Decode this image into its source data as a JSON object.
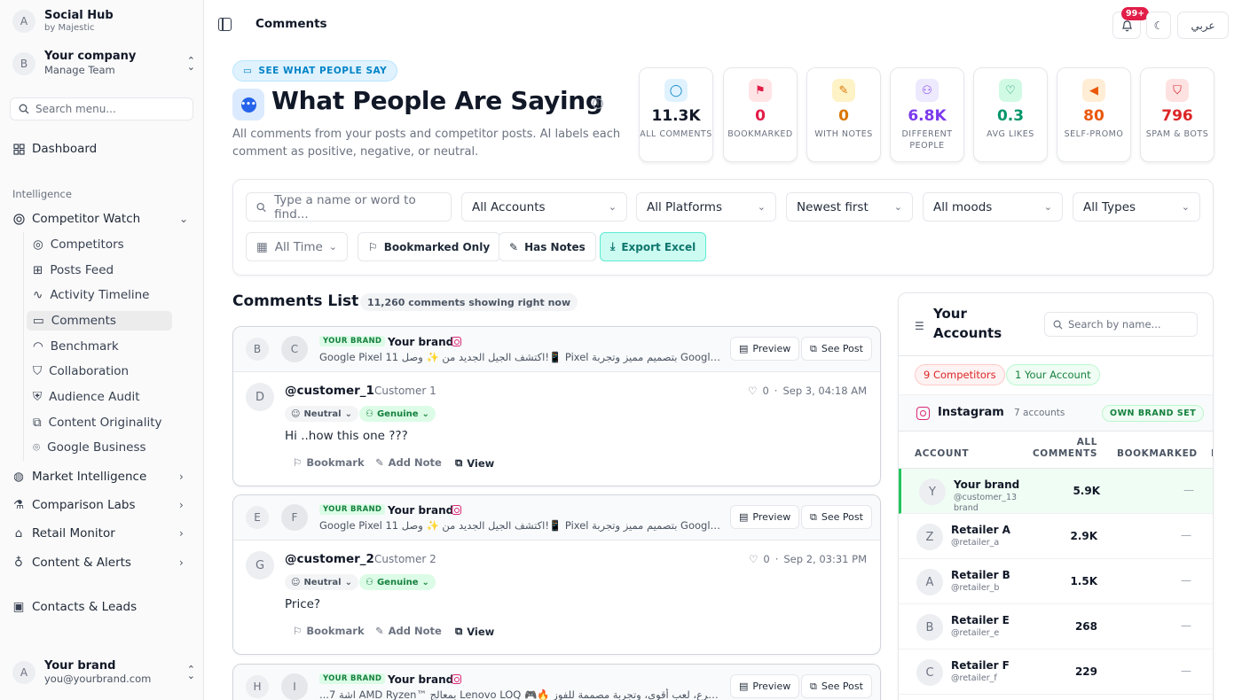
{
  "sidebar": {
    "brand_avatar": "A",
    "brand_title": "Social Hub",
    "brand_sub": "by Majestic",
    "company_avatar": "B",
    "company_title": "Your company",
    "company_sub": "Manage Team",
    "search_placeholder": "Search menu...",
    "dashboard": "Dashboard",
    "section_intelligence": "Intelligence",
    "competitor_watch": "Competitor Watch",
    "sub_items": [
      "Competitors",
      "Posts Feed",
      "Activity Timeline",
      "Comments",
      "Benchmark",
      "Collaboration",
      "Audience Audit",
      "Content Originality",
      "Google Business"
    ],
    "groups": [
      "Market Intelligence",
      "Comparison Labs",
      "Retail Monitor",
      "Content & Alerts"
    ],
    "contacts": "Contacts & Leads",
    "user_avatar": "A",
    "user_name": "Your brand",
    "user_email": "you@yourbrand.com"
  },
  "topbar": {
    "crumb": "Comments",
    "notif_badge": "99+",
    "lang_label": "عربي"
  },
  "hero": {
    "pill": "SEE WHAT PEOPLE SAY",
    "title": "What People Are Saying",
    "desc": "All comments from your posts and competitor posts. AI labels each comment as positive, negative, or neutral."
  },
  "stats": [
    {
      "value": "11.3K",
      "label": "ALL COMMENTS",
      "color": "#111827",
      "bg": "#e0f2fe",
      "icon": "comment-icon",
      "glyph": "◯",
      "icolor": "#0284c7"
    },
    {
      "value": "0",
      "label": "BOOKMARKED",
      "color": "#e11d48",
      "bg": "#ffe4e6",
      "icon": "flag-icon",
      "glyph": "⚑",
      "icolor": "#e11d48"
    },
    {
      "value": "0",
      "label": "WITH NOTES",
      "color": "#d97706",
      "bg": "#fef3c7",
      "icon": "note-icon",
      "glyph": "✎",
      "icolor": "#d97706"
    },
    {
      "value": "6.8K",
      "label": "DIFFERENT PEOPLE",
      "color": "#7c3aed",
      "bg": "#ede9fe",
      "icon": "people-icon",
      "glyph": "⚇",
      "icolor": "#7c3aed"
    },
    {
      "value": "0.3",
      "label": "AVG LIKES",
      "color": "#059669",
      "bg": "#d1fae5",
      "icon": "heart-icon",
      "glyph": "♡",
      "icolor": "#059669"
    },
    {
      "value": "80",
      "label": "SELF-PROMO",
      "color": "#ea580c",
      "bg": "#ffedd5",
      "icon": "megaphone-icon",
      "glyph": "◀",
      "icolor": "#ea580c"
    },
    {
      "value": "796",
      "label": "SPAM & BOTS",
      "color": "#dc2626",
      "bg": "#fee2e2",
      "icon": "shield-alert-icon",
      "glyph": "⛉",
      "icolor": "#dc2626"
    }
  ],
  "filters": {
    "search_placeholder": "Type a name or word to find...",
    "accounts": "All Accounts",
    "platforms": "All Platforms",
    "sort": "Newest first",
    "moods": "All moods",
    "types": "All Types",
    "time": "All Time",
    "bookmarked": "Bookmarked Only",
    "notes": "Has Notes",
    "export": "Export Excel"
  },
  "list": {
    "title": "Comments List",
    "count": "11,260 comments showing right now",
    "cards": [
      {
        "av1": "B",
        "av2": "C",
        "badge": "YOUR BRAND",
        "brand": "Your brand",
        "post": "Google Pixel 11 اكتشف الجيل الجديد من ✨ وصل!📱 Pixel بتصميم مميز وتجربة Google ...ا. م",
        "preview": "Preview",
        "see_post": "See Post",
        "cav": "D",
        "handle": "@customer_1",
        "name": "Customer 1",
        "likes": "0",
        "date": "Sep 3, 04:18 AM",
        "mood": "Neutral",
        "type": "Genuine",
        "text": "Hi ..how this one ???",
        "bookmark": "Bookmark",
        "add_note": "Add Note",
        "view": "View"
      },
      {
        "av1": "E",
        "av2": "F",
        "badge": "YOUR BRAND",
        "brand": "Your brand",
        "post": "Google Pixel 11 اكتشف الجيل الجديد من ✨ وصل!📱 Pixel بتصميم مميز وتجربة Google ...ا. م",
        "preview": "Preview",
        "see_post": "See Post",
        "cav": "G",
        "handle": "@customer_2",
        "name": "Customer 2",
        "likes": "0",
        "date": "Sep 2, 03:31 PM",
        "mood": "Neutral",
        "type": "Genuine",
        "text": "Price?",
        "bookmark": "Bookmark",
        "add_note": "Add Note",
        "view": "View"
      },
      {
        "av1": "H",
        "av2": "I",
        "badge": "YOUR BRAND",
        "brand": "Your brand",
        "post": "...اشة 7 AMD Ryzen™ بمعالج Lenovo LOQ 🎮🔥 أداء أسرع، لعب أقوى، وتجربة مصممة للفوز.",
        "preview": "Preview",
        "see_post": "See Post"
      }
    ]
  },
  "accounts": {
    "title": "Your Accounts",
    "search_placeholder": "Search by name...",
    "chip_competitors": "9 Competitors",
    "chip_own": "1 Your Account",
    "platform": "Instagram",
    "platform_count": "7 accounts",
    "own_badge": "OWN BRAND SET",
    "col_account": "ACCOUNT",
    "col_all_1": "ALL",
    "col_all_2": "COMMENTS",
    "col_bookmarked": "BOOKMARKED",
    "rows": [
      {
        "av": "Y",
        "name": "Your brand",
        "handle": "@customer_13 brand",
        "value": "5.9K",
        "bm": "—"
      },
      {
        "av": "Z",
        "name": "Retailer A",
        "handle": "@retailer_a",
        "value": "2.9K",
        "bm": "—"
      },
      {
        "av": "A",
        "name": "Retailer B",
        "handle": "@retailer_b",
        "value": "1.5K",
        "bm": "—"
      },
      {
        "av": "B",
        "name": "Retailer E",
        "handle": "@retailer_e",
        "value": "268",
        "bm": "—"
      },
      {
        "av": "C",
        "name": "Retailer F",
        "handle": "@retailer_f",
        "value": "229",
        "bm": "—"
      }
    ]
  }
}
